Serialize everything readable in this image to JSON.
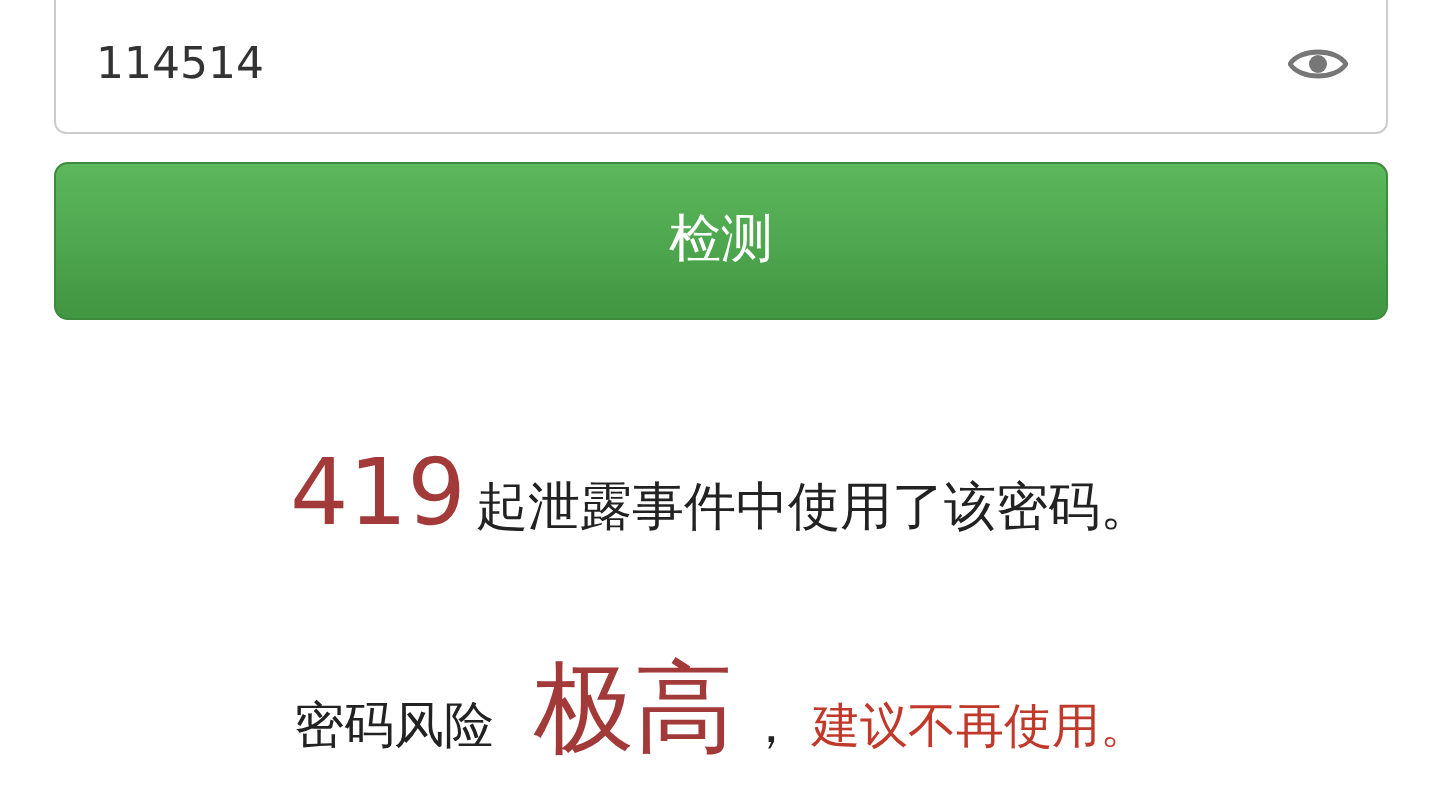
{
  "password_field": {
    "value": "114514"
  },
  "check_button": "检测",
  "result": {
    "count": "419",
    "count_text": "起泄露事件中使用了该密码。",
    "risk_label": "密码风险",
    "risk_level": "极高",
    "separator": "，",
    "advice": "建议不再使用。"
  }
}
